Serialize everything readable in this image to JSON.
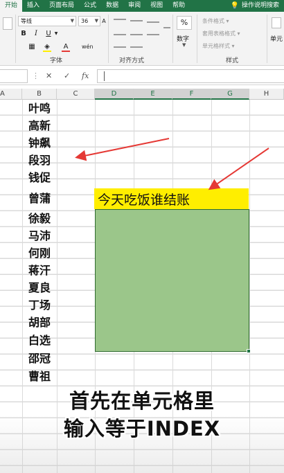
{
  "ribbon": {
    "tabs": [
      "开始",
      "插入",
      "页面布局",
      "公式",
      "数据",
      "审阅",
      "视图",
      "帮助",
      "操作说明搜索"
    ],
    "active_tab": "开始",
    "font_name": "等线",
    "font_size": "36",
    "bold": "B",
    "italic": "I",
    "underline": "U",
    "font_color_letter": "A",
    "group_font": "字体",
    "group_align": "对齐方式",
    "group_style": "样式",
    "number_label": "数字",
    "percent": "%",
    "cond_format": "条件格式 ▾",
    "table_format": "套用表格格式 ▾",
    "cell_style": "单元格样式 ▾",
    "cells_label": "单元"
  },
  "formula_bar": {
    "cancel": "✕",
    "confirm": "✓",
    "fx": "fx"
  },
  "columns": [
    "A",
    "B",
    "C",
    "D",
    "E",
    "F",
    "G",
    "H"
  ],
  "names": [
    "叶鸣",
    "高新",
    "钟飙",
    "段羽",
    "钱促",
    "曾蒲",
    "徐毅",
    "马沛",
    "何刚",
    "蒋汗",
    "夏良",
    "丁场",
    "胡部",
    "白选",
    "邵冠",
    "曹祖"
  ],
  "header_cell": "今天吃饭谁结账",
  "caption": {
    "line1": "首先在单元格里",
    "line2": "输入等于INDEX"
  },
  "colors": {
    "ribbon_green": "#217346",
    "yellow": "#ffee00",
    "green_fill": "#9bc68a",
    "arrow_red": "#e53935"
  }
}
